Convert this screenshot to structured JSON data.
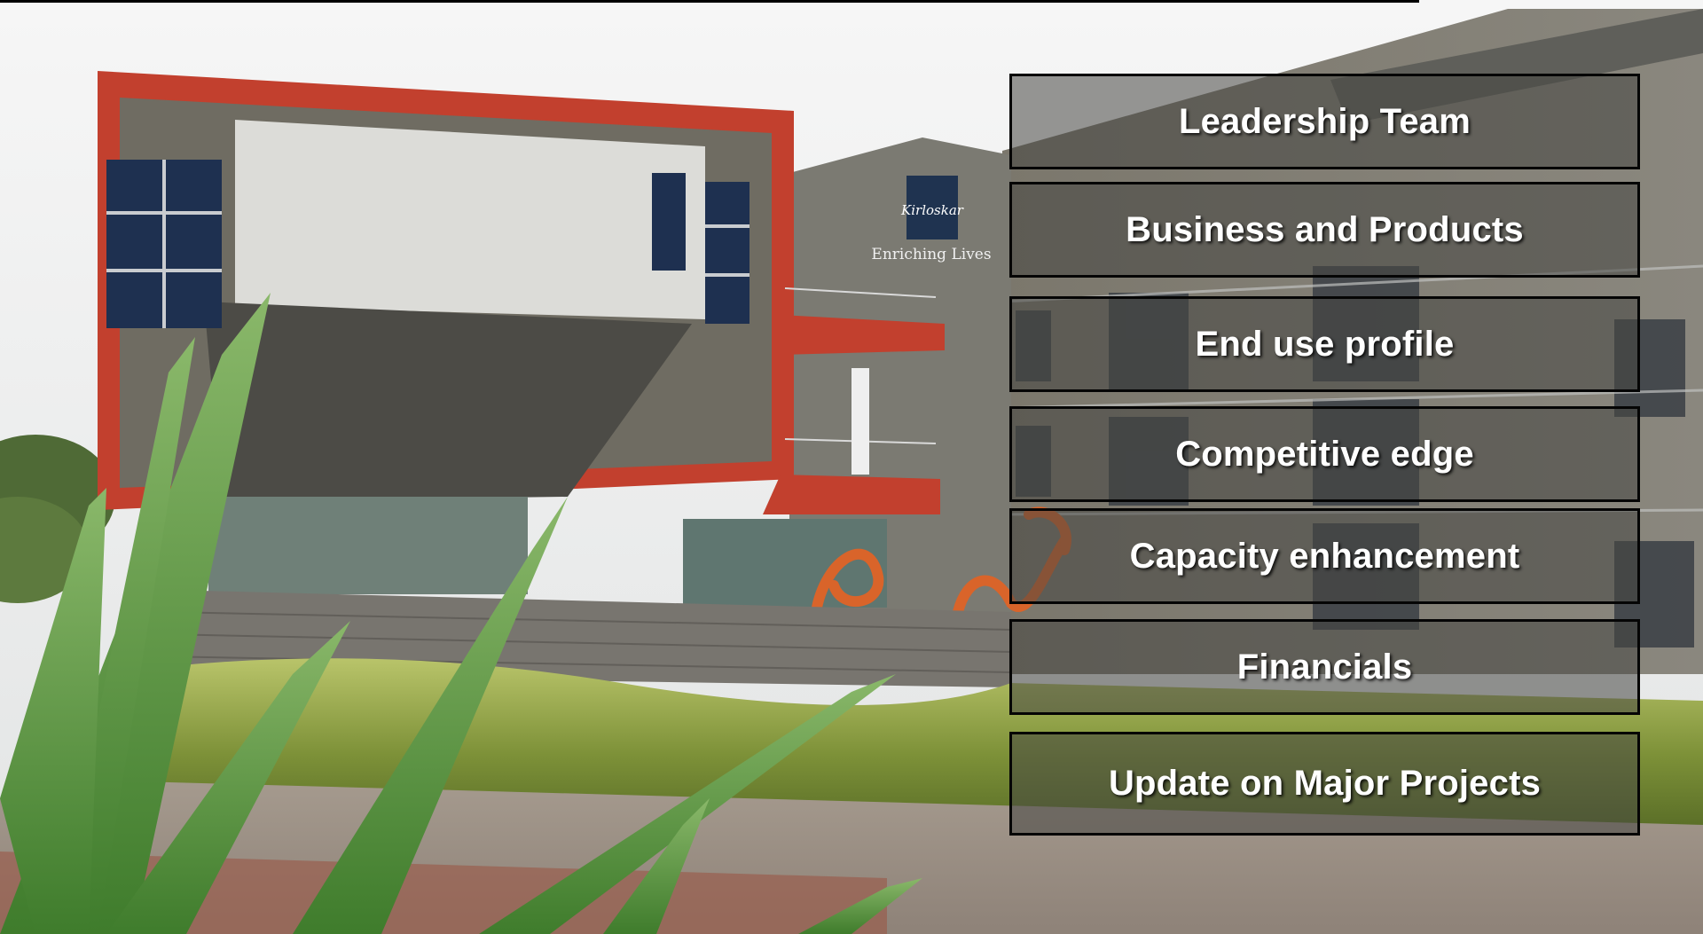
{
  "slide": {
    "background_photo": {
      "description_icon": "office-building-photo-icon",
      "signage_logo_text": "Kirloskar",
      "signage_tagline": "Enriching Lives"
    },
    "menu": {
      "items": [
        {
          "label": "Leadership Team"
        },
        {
          "label": "Business and Products"
        },
        {
          "label": "End use profile"
        },
        {
          "label": "Competitive edge"
        },
        {
          "label": "Capacity enhancement"
        },
        {
          "label": "Financials"
        },
        {
          "label": "Update on Major Projects"
        }
      ]
    }
  },
  "colors": {
    "brand_red": "#c2402e",
    "menu_overlay": "#46463f",
    "menu_border": "#050505",
    "menu_text": "#ffffff"
  }
}
